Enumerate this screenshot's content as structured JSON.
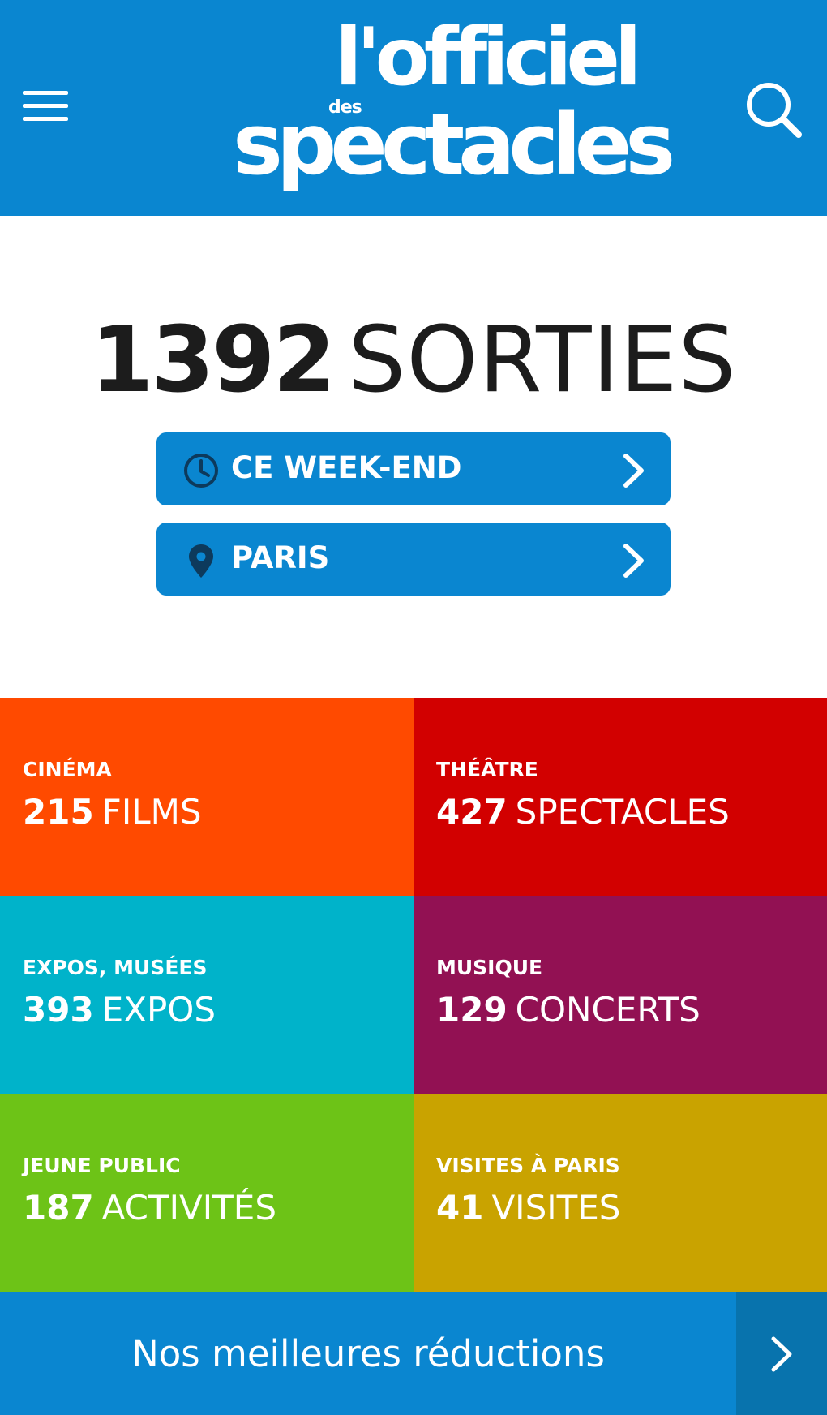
{
  "header": {
    "logo": {
      "line1": "l'officiel",
      "small": "des",
      "line2": "spectacles"
    },
    "menu_icon": "hamburger-menu-icon",
    "search_icon": "search-icon",
    "background": "#0a86d0"
  },
  "hero": {
    "count": "1392",
    "label": "SORTIES"
  },
  "filters": [
    {
      "label": "CE WEEK-END",
      "icon": "clock-icon"
    },
    {
      "label": "PARIS",
      "icon": "location-pin-icon"
    }
  ],
  "categories": [
    {
      "category": "CINÉMA",
      "count": "215",
      "unit": "FILMS",
      "color": "#ff4a00"
    },
    {
      "category": "THÉÂTRE",
      "count": "427",
      "unit": "SPECTACLES",
      "color": "#d20000"
    },
    {
      "category": "EXPOS, MUSÉES",
      "count": "393",
      "unit": "EXPOS",
      "color": "#00b3ca"
    },
    {
      "category": "MUSIQUE",
      "count": "129",
      "unit": "CONCERTS",
      "color": "#921153"
    },
    {
      "category": "JEUNE PUBLIC",
      "count": "187",
      "unit": "ACTIVITÉS",
      "color": "#6dc317"
    },
    {
      "category": "VISITES À PARIS",
      "count": "41",
      "unit": "VISITES",
      "color": "#c9a300"
    }
  ],
  "promo": {
    "label": "Nos meilleures réductions",
    "arrow_icon": "chevron-right-icon"
  }
}
